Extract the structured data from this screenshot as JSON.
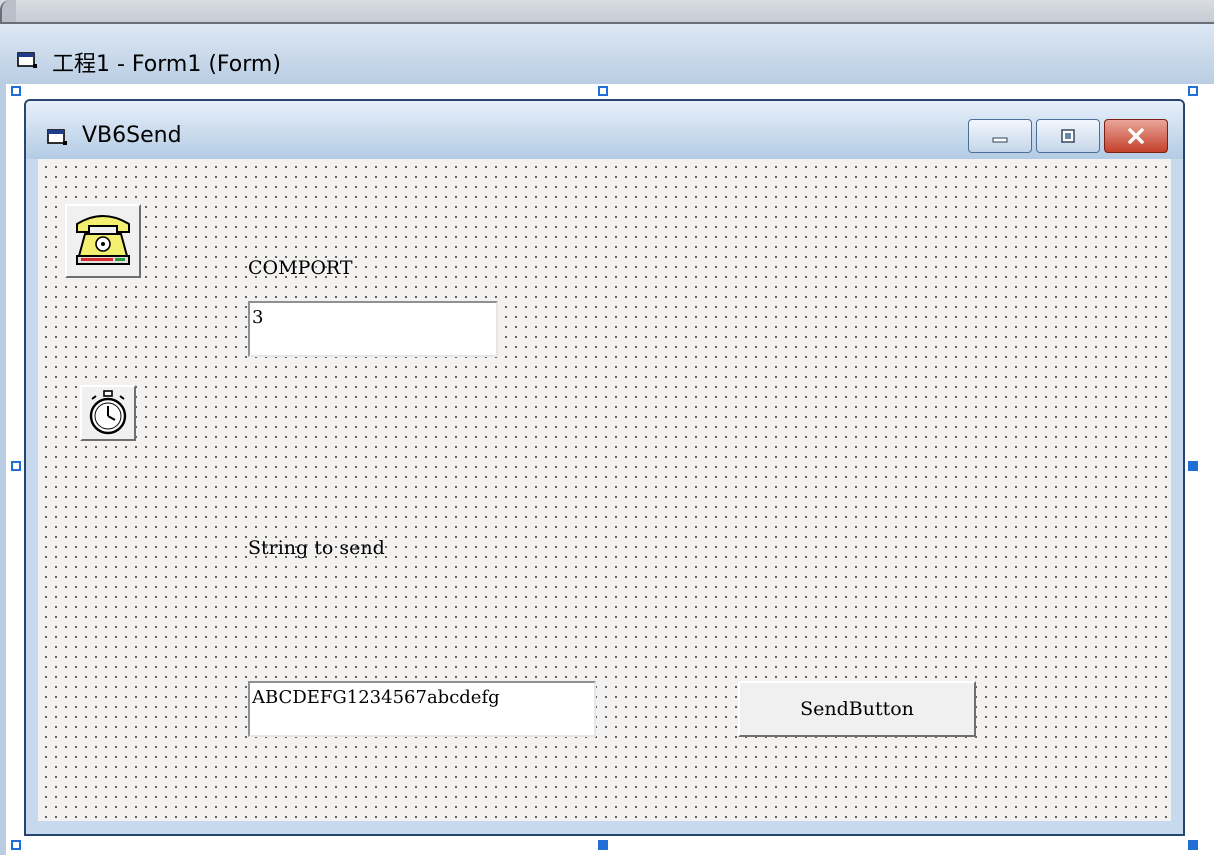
{
  "designer": {
    "title": "工程1 - Form1 (Form)",
    "icon": "form-icon"
  },
  "form": {
    "caption": "VB6Send",
    "icon": "form-icon",
    "caption_buttons": [
      "minimize-icon",
      "maximize-icon",
      "close-icon"
    ]
  },
  "controls": {
    "comm_icon": "telephone-icon",
    "timer_icon": "stopwatch-icon",
    "comport_label": "COMPORT",
    "comport_value": "3",
    "string_label": "String to send",
    "string_value": "ABCDEFG1234567abcdefg",
    "send_button": "SendButton"
  },
  "colors": {
    "selection_handles": "#1f6fd6",
    "close_button": "#c4402c",
    "form_background": "#f3f2f1"
  }
}
